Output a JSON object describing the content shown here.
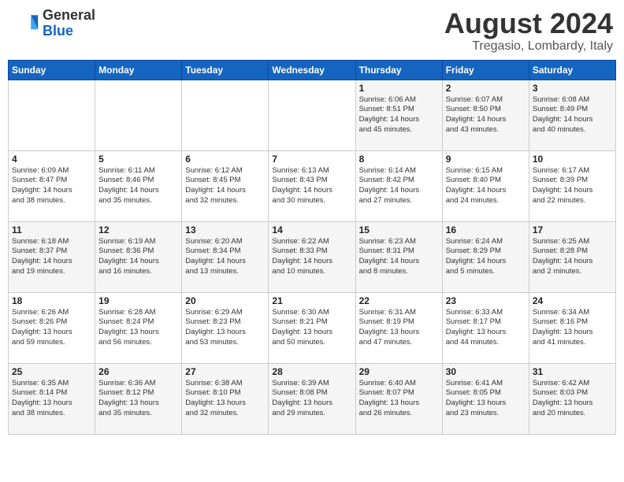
{
  "header": {
    "logo_general": "General",
    "logo_blue": "Blue",
    "month_year": "August 2024",
    "location": "Tregasio, Lombardy, Italy"
  },
  "weekdays": [
    "Sunday",
    "Monday",
    "Tuesday",
    "Wednesday",
    "Thursday",
    "Friday",
    "Saturday"
  ],
  "weeks": [
    [
      {
        "day": "",
        "detail": ""
      },
      {
        "day": "",
        "detail": ""
      },
      {
        "day": "",
        "detail": ""
      },
      {
        "day": "",
        "detail": ""
      },
      {
        "day": "1",
        "detail": "Sunrise: 6:06 AM\nSunset: 8:51 PM\nDaylight: 14 hours\nand 45 minutes."
      },
      {
        "day": "2",
        "detail": "Sunrise: 6:07 AM\nSunset: 8:50 PM\nDaylight: 14 hours\nand 43 minutes."
      },
      {
        "day": "3",
        "detail": "Sunrise: 6:08 AM\nSunset: 8:49 PM\nDaylight: 14 hours\nand 40 minutes."
      }
    ],
    [
      {
        "day": "4",
        "detail": "Sunrise: 6:09 AM\nSunset: 8:47 PM\nDaylight: 14 hours\nand 38 minutes."
      },
      {
        "day": "5",
        "detail": "Sunrise: 6:11 AM\nSunset: 8:46 PM\nDaylight: 14 hours\nand 35 minutes."
      },
      {
        "day": "6",
        "detail": "Sunrise: 6:12 AM\nSunset: 8:45 PM\nDaylight: 14 hours\nand 32 minutes."
      },
      {
        "day": "7",
        "detail": "Sunrise: 6:13 AM\nSunset: 8:43 PM\nDaylight: 14 hours\nand 30 minutes."
      },
      {
        "day": "8",
        "detail": "Sunrise: 6:14 AM\nSunset: 8:42 PM\nDaylight: 14 hours\nand 27 minutes."
      },
      {
        "day": "9",
        "detail": "Sunrise: 6:15 AM\nSunset: 8:40 PM\nDaylight: 14 hours\nand 24 minutes."
      },
      {
        "day": "10",
        "detail": "Sunrise: 6:17 AM\nSunset: 8:39 PM\nDaylight: 14 hours\nand 22 minutes."
      }
    ],
    [
      {
        "day": "11",
        "detail": "Sunrise: 6:18 AM\nSunset: 8:37 PM\nDaylight: 14 hours\nand 19 minutes."
      },
      {
        "day": "12",
        "detail": "Sunrise: 6:19 AM\nSunset: 8:36 PM\nDaylight: 14 hours\nand 16 minutes."
      },
      {
        "day": "13",
        "detail": "Sunrise: 6:20 AM\nSunset: 8:34 PM\nDaylight: 14 hours\nand 13 minutes."
      },
      {
        "day": "14",
        "detail": "Sunrise: 6:22 AM\nSunset: 8:33 PM\nDaylight: 14 hours\nand 10 minutes."
      },
      {
        "day": "15",
        "detail": "Sunrise: 6:23 AM\nSunset: 8:31 PM\nDaylight: 14 hours\nand 8 minutes."
      },
      {
        "day": "16",
        "detail": "Sunrise: 6:24 AM\nSunset: 8:29 PM\nDaylight: 14 hours\nand 5 minutes."
      },
      {
        "day": "17",
        "detail": "Sunrise: 6:25 AM\nSunset: 8:28 PM\nDaylight: 14 hours\nand 2 minutes."
      }
    ],
    [
      {
        "day": "18",
        "detail": "Sunrise: 6:26 AM\nSunset: 8:26 PM\nDaylight: 13 hours\nand 59 minutes."
      },
      {
        "day": "19",
        "detail": "Sunrise: 6:28 AM\nSunset: 8:24 PM\nDaylight: 13 hours\nand 56 minutes."
      },
      {
        "day": "20",
        "detail": "Sunrise: 6:29 AM\nSunset: 8:23 PM\nDaylight: 13 hours\nand 53 minutes."
      },
      {
        "day": "21",
        "detail": "Sunrise: 6:30 AM\nSunset: 8:21 PM\nDaylight: 13 hours\nand 50 minutes."
      },
      {
        "day": "22",
        "detail": "Sunrise: 6:31 AM\nSunset: 8:19 PM\nDaylight: 13 hours\nand 47 minutes."
      },
      {
        "day": "23",
        "detail": "Sunrise: 6:33 AM\nSunset: 8:17 PM\nDaylight: 13 hours\nand 44 minutes."
      },
      {
        "day": "24",
        "detail": "Sunrise: 6:34 AM\nSunset: 8:16 PM\nDaylight: 13 hours\nand 41 minutes."
      }
    ],
    [
      {
        "day": "25",
        "detail": "Sunrise: 6:35 AM\nSunset: 8:14 PM\nDaylight: 13 hours\nand 38 minutes."
      },
      {
        "day": "26",
        "detail": "Sunrise: 6:36 AM\nSunset: 8:12 PM\nDaylight: 13 hours\nand 35 minutes."
      },
      {
        "day": "27",
        "detail": "Sunrise: 6:38 AM\nSunset: 8:10 PM\nDaylight: 13 hours\nand 32 minutes."
      },
      {
        "day": "28",
        "detail": "Sunrise: 6:39 AM\nSunset: 8:08 PM\nDaylight: 13 hours\nand 29 minutes."
      },
      {
        "day": "29",
        "detail": "Sunrise: 6:40 AM\nSunset: 8:07 PM\nDaylight: 13 hours\nand 26 minutes."
      },
      {
        "day": "30",
        "detail": "Sunrise: 6:41 AM\nSunset: 8:05 PM\nDaylight: 13 hours\nand 23 minutes."
      },
      {
        "day": "31",
        "detail": "Sunrise: 6:42 AM\nSunset: 8:03 PM\nDaylight: 13 hours\nand 20 minutes."
      }
    ]
  ]
}
